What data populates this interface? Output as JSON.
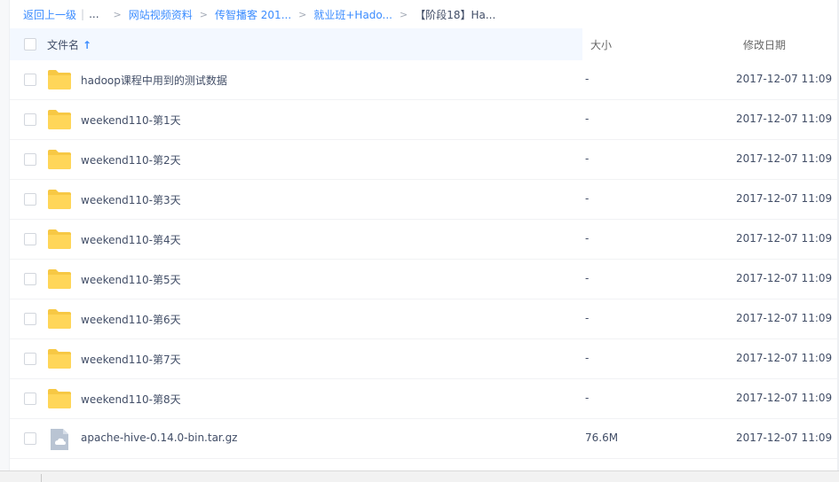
{
  "breadcrumb": {
    "back": "返回上一级",
    "sep_bar": "|",
    "ellipsis": "...",
    "sep": ">",
    "items": [
      "网站视频资料",
      "传智播客 201...",
      "就业班+Hado..."
    ],
    "current": "【阶段18】Ha..."
  },
  "header": {
    "name": "文件名",
    "sort": "↑",
    "size": "大小",
    "date": "修改日期"
  },
  "rows": [
    {
      "name": "hadoop课程中用到的测试数据",
      "size": "-",
      "date": "2017-12-07 11:09",
      "icon": "folder-icon"
    },
    {
      "name": "weekend110-第1天",
      "size": "-",
      "date": "2017-12-07 11:09",
      "icon": "folder-icon"
    },
    {
      "name": "weekend110-第2天",
      "size": "-",
      "date": "2017-12-07 11:09",
      "icon": "folder-icon"
    },
    {
      "name": "weekend110-第3天",
      "size": "-",
      "date": "2017-12-07 11:09",
      "icon": "folder-icon"
    },
    {
      "name": "weekend110-第4天",
      "size": "-",
      "date": "2017-12-07 11:09",
      "icon": "folder-icon"
    },
    {
      "name": "weekend110-第5天",
      "size": "-",
      "date": "2017-12-07 11:09",
      "icon": "folder-icon"
    },
    {
      "name": "weekend110-第6天",
      "size": "-",
      "date": "2017-12-07 11:09",
      "icon": "folder-icon"
    },
    {
      "name": "weekend110-第7天",
      "size": "-",
      "date": "2017-12-07 11:09",
      "icon": "folder-icon"
    },
    {
      "name": "weekend110-第8天",
      "size": "-",
      "date": "2017-12-07 11:09",
      "icon": "folder-icon"
    },
    {
      "name": "apache-hive-0.14.0-bin.tar.gz",
      "size": "76.6M",
      "date": "2017-12-07 11:09",
      "icon": "archive-file-icon"
    }
  ],
  "colors": {
    "accent": "#3b8cff",
    "folder": "#ffd659",
    "file": "#b9c4d3"
  }
}
